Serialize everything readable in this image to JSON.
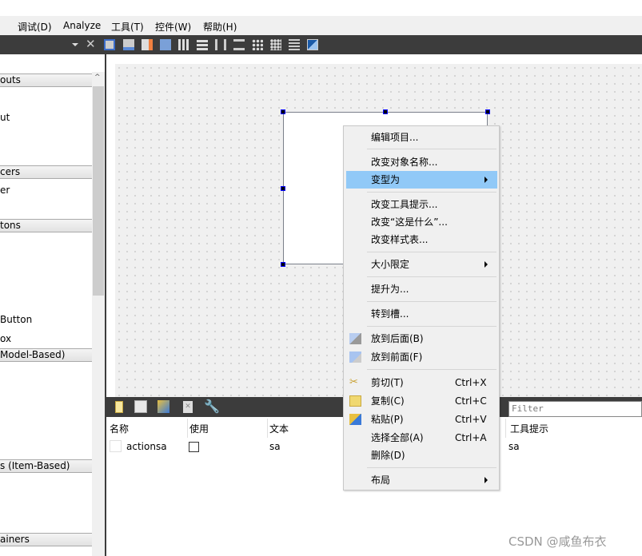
{
  "menubar": {
    "items": [
      "调试(D)",
      "Analyze",
      "工具(T)",
      "控件(W)",
      "帮助(H)"
    ]
  },
  "toolbar": {
    "icons": [
      "dropdown-arrow-icon",
      "close-icon",
      "edit-widgets-icon",
      "edit-signals-slots-icon",
      "edit-buddies-icon",
      "edit-tab-order-icon",
      "layout-horizontal-icon",
      "layout-vertical-icon",
      "layout-horizontal-splitter-icon",
      "layout-vertical-splitter-icon",
      "layout-form-icon",
      "layout-grid-icon",
      "break-layout-icon",
      "adjust-size-icon"
    ]
  },
  "widgetbox": {
    "categories": [
      "outs",
      "cers",
      "tons",
      "Model-Based)",
      "s (Item-Based)",
      "ainers"
    ],
    "items": [
      "ut",
      "er",
      "Button",
      "ox"
    ]
  },
  "actioneditor": {
    "filter_placeholder": "Filter",
    "columns": [
      "名称",
      "使用",
      "文本",
      "工具提示"
    ],
    "rows": [
      {
        "name": "actionsa",
        "used": false,
        "text": "sa",
        "tooltip": "sa"
      }
    ]
  },
  "context_menu": {
    "items": [
      {
        "label": "编辑项目..."
      },
      {
        "label": "改变对象名称..."
      },
      {
        "label": "变型为",
        "submenu": true,
        "highlighted": true
      },
      {
        "label": "改变工具提示..."
      },
      {
        "label": "改变“这是什么”..."
      },
      {
        "label": "改变样式表..."
      },
      {
        "label": "大小限定",
        "submenu": true
      },
      {
        "label": "提升为..."
      },
      {
        "label": "转到槽..."
      },
      {
        "label": "放到后面(B)",
        "icon": "send-to-back-icon"
      },
      {
        "label": "放到前面(F)",
        "icon": "bring-to-front-icon"
      },
      {
        "label": "剪切(T)",
        "shortcut": "Ctrl+X",
        "icon": "cut-icon"
      },
      {
        "label": "复制(C)",
        "shortcut": "Ctrl+C",
        "icon": "copy-icon"
      },
      {
        "label": "粘贴(P)",
        "shortcut": "Ctrl+V",
        "icon": "paste-icon"
      },
      {
        "label": "选择全部(A)",
        "shortcut": "Ctrl+A"
      },
      {
        "label": "删除(D)"
      },
      {
        "label": "布局",
        "submenu": true
      }
    ]
  },
  "watermark": "CSDN @咸鱼布衣",
  "colors": {
    "highlight": "#91c9f7",
    "toolbar": "#3c3c3c",
    "handle": "#0000ff"
  }
}
